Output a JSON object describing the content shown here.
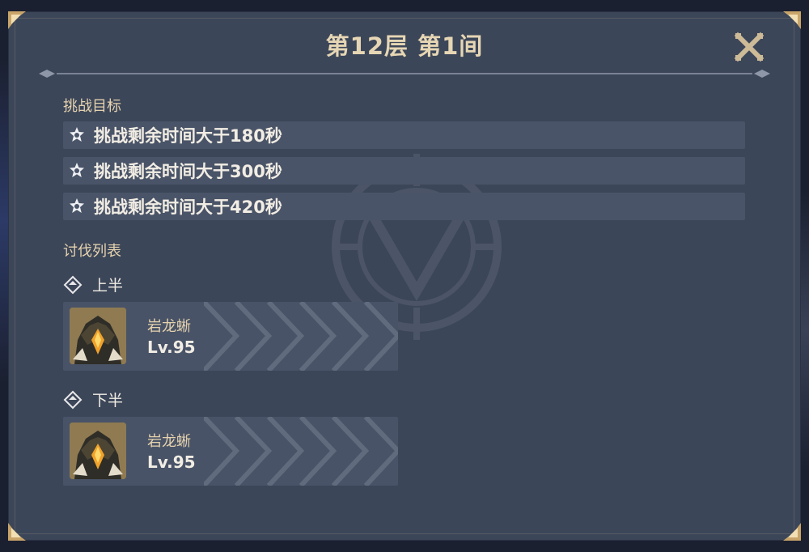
{
  "title": "第12层 第1间",
  "colors": {
    "panel": "#3c4659",
    "accent_gold": "#e6d6b4",
    "row_bg": "#4a5468"
  },
  "goals": {
    "label": "挑战目标",
    "items": [
      {
        "text": "挑战剩余时间大于180秒",
        "icon": "star-icon"
      },
      {
        "text": "挑战剩余时间大于300秒",
        "icon": "star-icon"
      },
      {
        "text": "挑战剩余时间大于420秒",
        "icon": "star-icon"
      }
    ]
  },
  "enemies": {
    "label": "讨伐列表",
    "halves": [
      {
        "label": "上半",
        "icon": "diamond-icon",
        "enemy": {
          "name": "岩龙蜥",
          "level": "Lv.95",
          "icon": "geovishap-portrait"
        }
      },
      {
        "label": "下半",
        "icon": "diamond-icon",
        "enemy": {
          "name": "岩龙蜥",
          "level": "Lv.95",
          "icon": "geovishap-portrait"
        }
      }
    ]
  },
  "close_icon": "close-icon"
}
